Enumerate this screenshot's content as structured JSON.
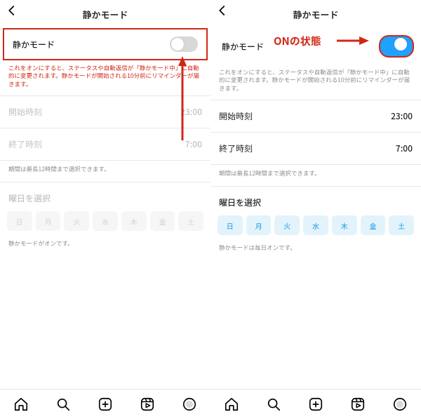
{
  "left": {
    "header": {
      "title": "静かモード"
    },
    "toggle": {
      "label": "静かモード",
      "on": false
    },
    "description": "これをオンにすると、ステータスや自動返信が「静かモード中」に自動的に変更されます。静かモードが開始される10分前にリマインダーが届きます。",
    "rows": {
      "start": {
        "label": "開始時刻",
        "value": "23:00"
      },
      "end": {
        "label": "終了時刻",
        "value": "7:00"
      }
    },
    "period_note": "期間は最長12時間まで選択できます。",
    "days_title": "曜日を選択",
    "days": [
      "日",
      "月",
      "火",
      "水",
      "木",
      "金",
      "土"
    ],
    "days_note": "静かモードがオンです。"
  },
  "right": {
    "header": {
      "title": "静かモード"
    },
    "toggle": {
      "label": "静かモード",
      "on": true
    },
    "description": "これをオンにすると、ステータスや自動返信が「静かモード中」に自動的に変更されます。静かモードが開始される10分前にリマインダーが届きます。",
    "rows": {
      "start": {
        "label": "開始時刻",
        "value": "23:00"
      },
      "end": {
        "label": "終了時刻",
        "value": "7:00"
      }
    },
    "period_note": "期間は最長12時間まで選択できます。",
    "days_title": "曜日を選択",
    "days": [
      "日",
      "月",
      "火",
      "水",
      "木",
      "金",
      "土"
    ],
    "days_note": "静かモードは毎日オンです。"
  },
  "annotation": {
    "on_state_label": "ONの状態"
  }
}
